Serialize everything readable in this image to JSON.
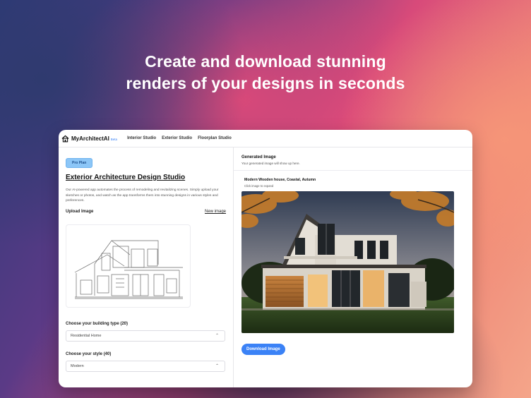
{
  "headline": {
    "line1": "Create and download stunning",
    "line2": "renders of your designs in seconds"
  },
  "app": {
    "name": "MyArchitectAI",
    "beta": "Beta",
    "logo_icon": "house-icon"
  },
  "nav": {
    "items": [
      {
        "label": "Interior Studio"
      },
      {
        "label": "Exterior Studio"
      },
      {
        "label": "Floorplan Studio"
      }
    ]
  },
  "left": {
    "badge": "Pro Plan",
    "title": "Exterior Architecture Design Studio",
    "description": "Our AI-powered app automates the process of remodeling and revitalizing scenes. Simply upload your sketches or photos, and watch as the app transforms them into stunning designs in various styles and preferences.",
    "upload_label": "Upload Image",
    "new_image": "New image",
    "building_type": {
      "label": "Choose your building type (20)",
      "value": "Residential Home"
    },
    "style": {
      "label": "Choose your style (40)",
      "value": "Modern"
    }
  },
  "right": {
    "title": "Generated Image",
    "subtitle": "Your generated image will show up here.",
    "image_title": "Modern Wooden house, Coastal, Autumn",
    "image_hint": "Click image to expand",
    "download_label": "Download Image"
  },
  "colors": {
    "accent": "#3b82f6",
    "badge_bg": "#8cc6f7"
  }
}
